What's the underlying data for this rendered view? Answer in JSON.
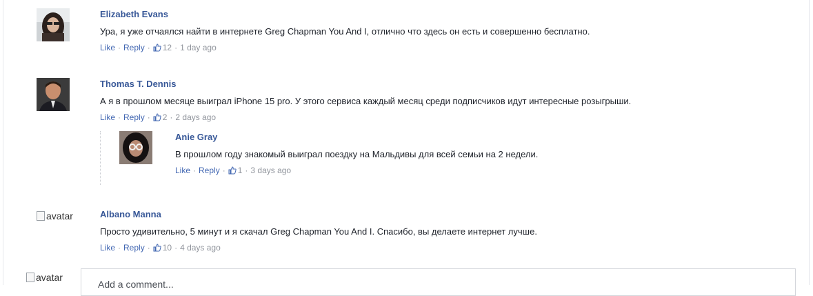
{
  "comments": [
    {
      "author": "Elizabeth Evans",
      "text": "Ура, я уже отчаялся найти в интернете Greg Chapman You And I, отлично что здесь он есть и совершенно бесплатно.",
      "like": "Like",
      "reply": "Reply",
      "likes": "12",
      "time": "1 day ago"
    },
    {
      "author": "Thomas T. Dennis",
      "text": "А я в прошлом месяце выиграл iPhone 15 pro. У этого сервиса каждый месяц среди подписчиков идут интересные розыгрыши.",
      "like": "Like",
      "reply": "Reply",
      "likes": "2",
      "time": "2 days ago"
    },
    {
      "author": "Anie Gray",
      "text": "В прошлом году знакомый выиграл поездку на Мальдивы для всей семьи на 2 недели.",
      "like": "Like",
      "reply": "Reply",
      "likes": "1",
      "time": "3 days ago"
    },
    {
      "author": "Albano Manna",
      "avatar_alt": "avatar",
      "text": "Просто удивительно, 5 минут и я скачал Greg Chapman You And I. Спасибо, вы делаете интернет лучше.",
      "like": "Like",
      "reply": "Reply",
      "likes": "10",
      "time": "4 days ago"
    }
  ],
  "composer": {
    "avatar_alt": "avatar",
    "placeholder": "Add a comment..."
  },
  "separator": "·",
  "colors": {
    "link": "#4267b2",
    "author": "#385898",
    "meta": "#90949c"
  }
}
